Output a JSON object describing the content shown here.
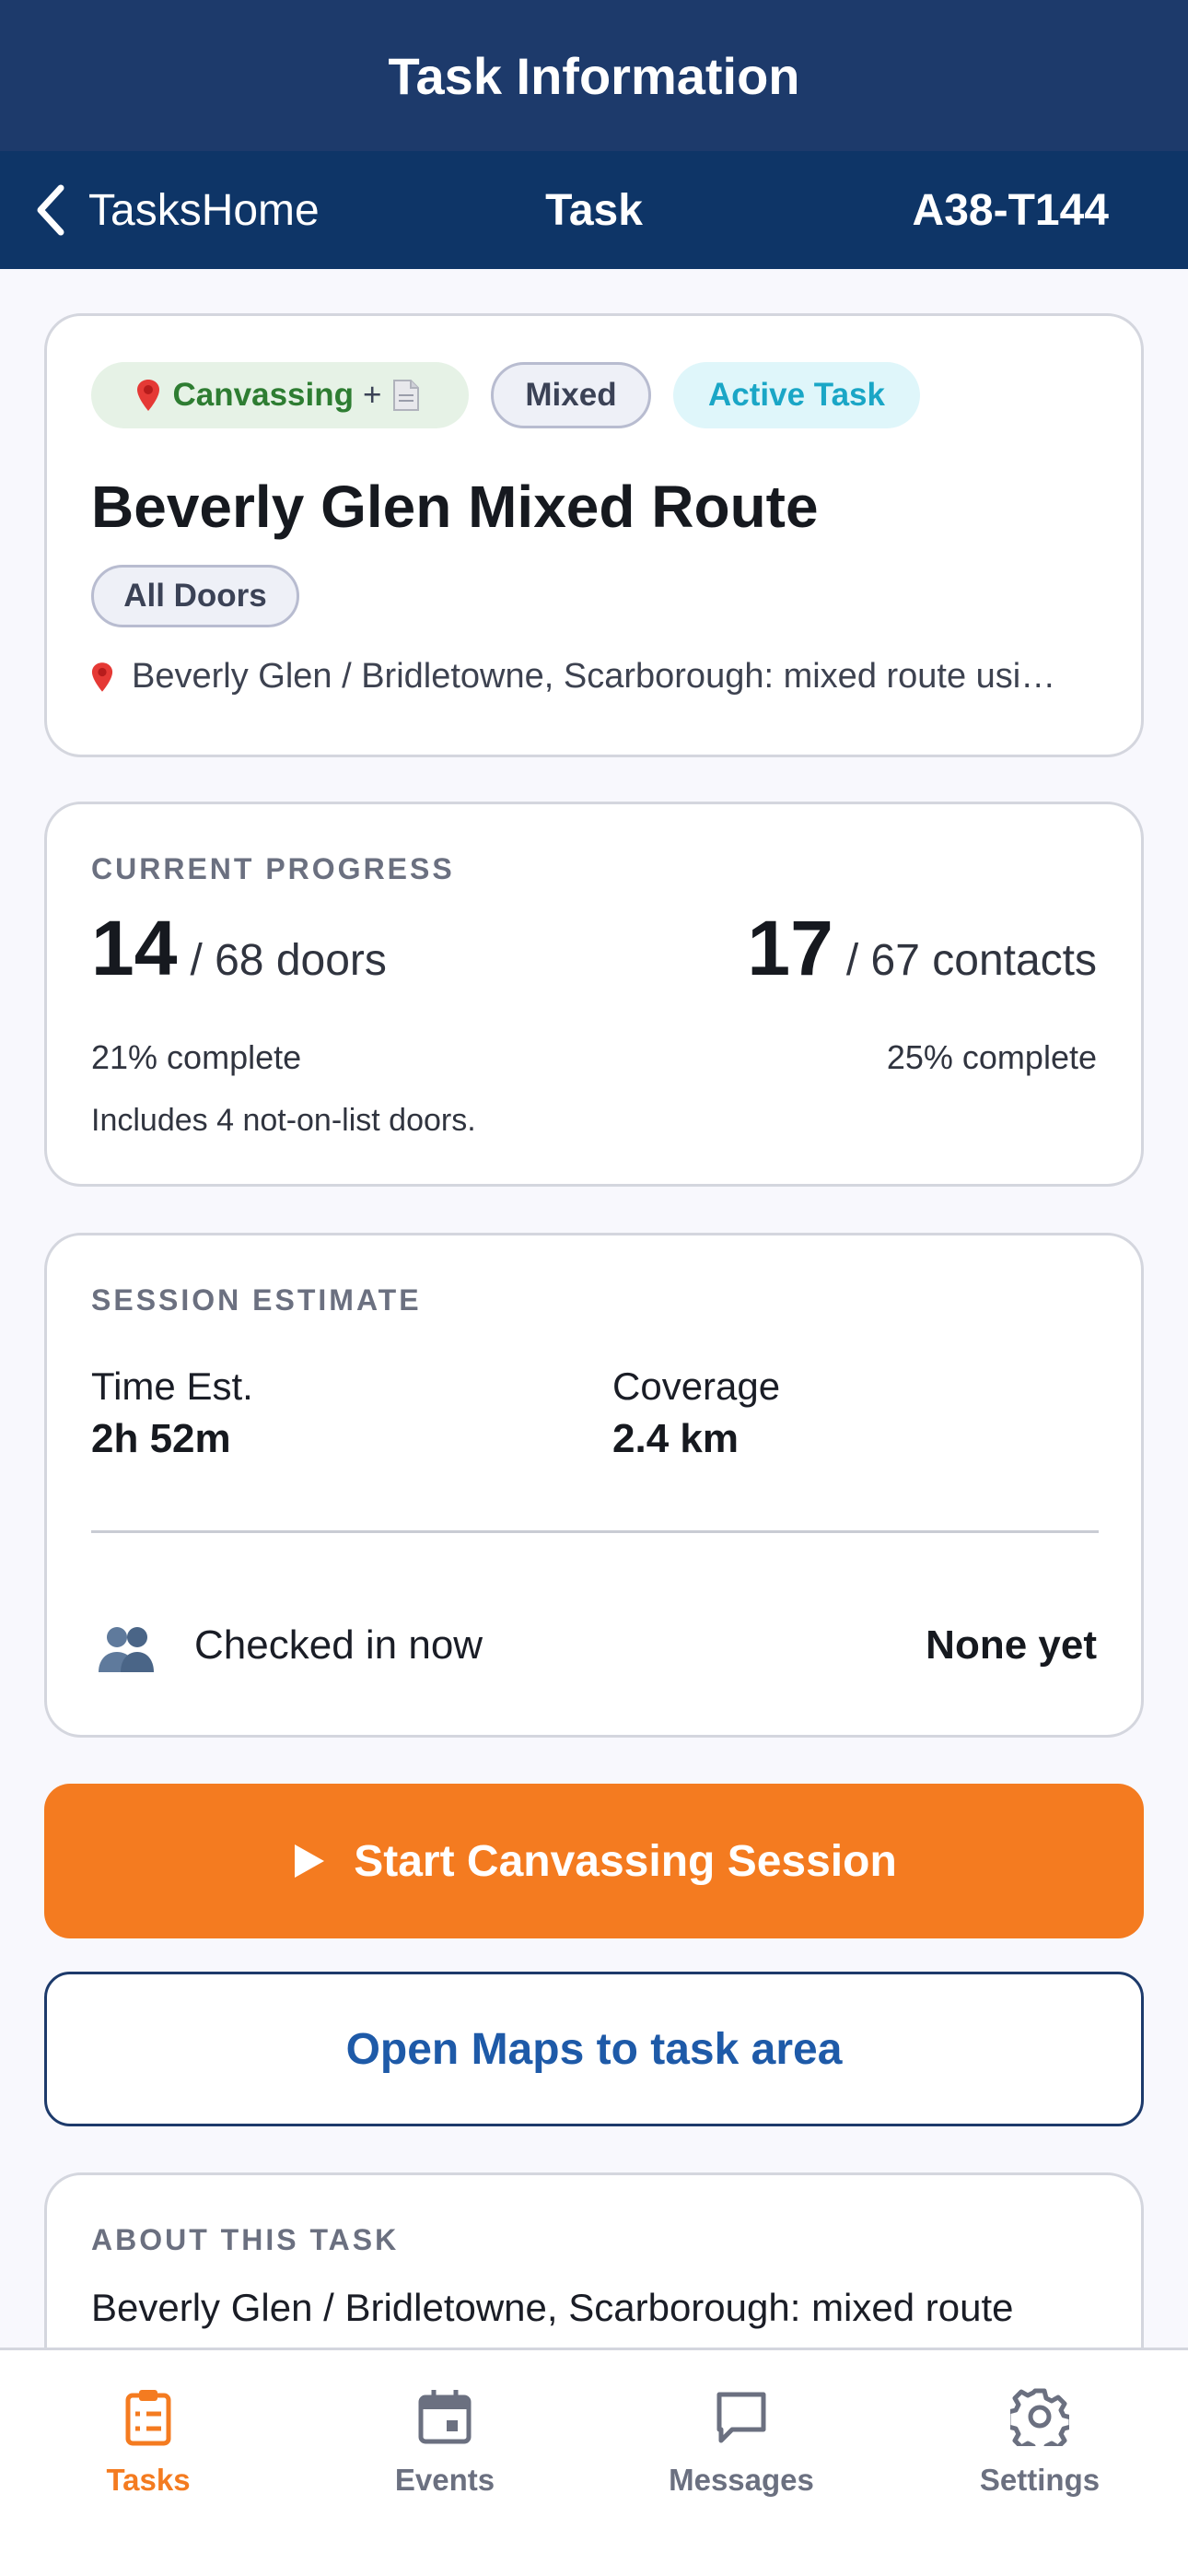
{
  "window": {
    "title": "Task Information"
  },
  "nav": {
    "back_label": "TasksHome",
    "title": "Task",
    "task_id": "A38-T144"
  },
  "task": {
    "type_label": "Canvassing",
    "type_plus": "+",
    "mixed_label": "Mixed",
    "status_label": "Active Task",
    "name": "Beverly Glen Mixed Route",
    "scope_label": "All Doors",
    "address": "Beverly Glen / Bridletowne, Scarborough: mixed route usi…"
  },
  "progress": {
    "section_label": "CURRENT PROGRESS",
    "doors_done": "14",
    "doors_unit": "/ 68 doors",
    "doors_pct": "21% complete",
    "contacts_done": "17",
    "contacts_unit": "/ 67 contacts",
    "contacts_pct": "25% complete",
    "note": "Includes 4 not-on-list doors."
  },
  "estimate": {
    "section_label": "SESSION ESTIMATE",
    "time_label": "Time Est.",
    "time_value": "2h 52m",
    "coverage_label": "Coverage",
    "coverage_value": "2.4 km",
    "checked_label": "Checked in now",
    "checked_value": "None yet"
  },
  "actions": {
    "start_label": "Start Canvassing Session",
    "maps_label": "Open Maps to task area"
  },
  "about": {
    "section_label": "ABOUT THIS TASK",
    "text": "Beverly Glen / Bridletowne, Scarborough: mixed route"
  },
  "tabs": [
    {
      "label": "Tasks",
      "icon": "clipboard-list-icon",
      "active": true
    },
    {
      "label": "Events",
      "icon": "calendar-icon",
      "active": false
    },
    {
      "label": "Messages",
      "icon": "chat-bubble-icon",
      "active": false
    },
    {
      "label": "Settings",
      "icon": "gear-icon",
      "active": false
    }
  ],
  "colors": {
    "header_bg": "#1d3a6b",
    "nav_bg": "#0e3567",
    "accent_orange": "#f47b20",
    "link_blue": "#1e5aa8",
    "canvass_green": "#2e7d32",
    "active_cyan": "#1aa6c6"
  }
}
